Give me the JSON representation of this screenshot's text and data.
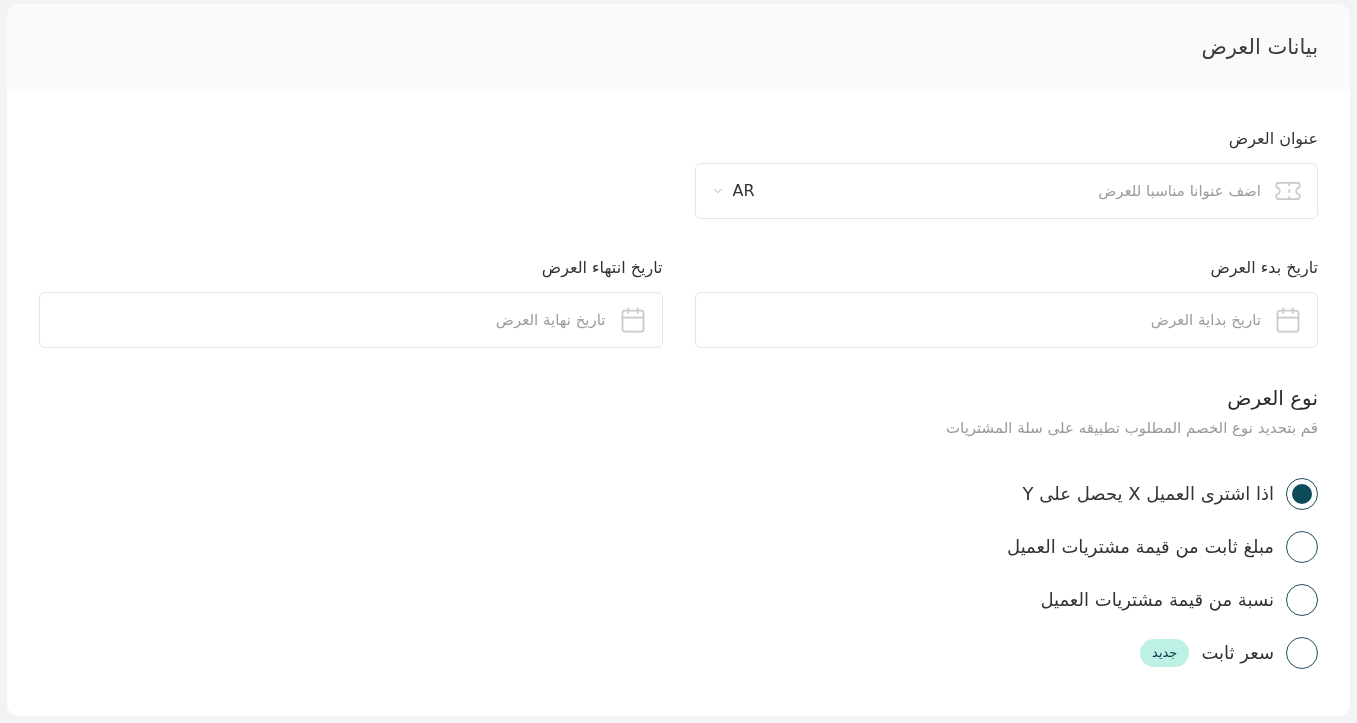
{
  "card": {
    "title": "بيانات العرض"
  },
  "title_field": {
    "label": "عنوان العرض",
    "placeholder": "اضف عنوانا مناسبا للعرض",
    "language": "AR"
  },
  "date_fields": [
    {
      "label": "تاريخ بدء العرض",
      "placeholder": "تاريخ بداية العرض"
    },
    {
      "label": "تاريخ انتهاء العرض",
      "placeholder": "تاريخ نهاية العرض"
    }
  ],
  "offer_type": {
    "title": "نوع العرض",
    "description": "قم بتحديد نوع الخصم المطلوب تطبيقه على سلة المشتريات",
    "options": [
      {
        "label": "اذا اشترى العميل X يحصل على Y",
        "selected": true
      },
      {
        "label": "مبلغ ثابت من قيمة مشتريات العميل",
        "selected": false
      },
      {
        "label": "نسبة من قيمة مشتريات العميل",
        "selected": false
      },
      {
        "label": "سعر ثابت",
        "selected": false,
        "badge": "جديد"
      }
    ]
  }
}
